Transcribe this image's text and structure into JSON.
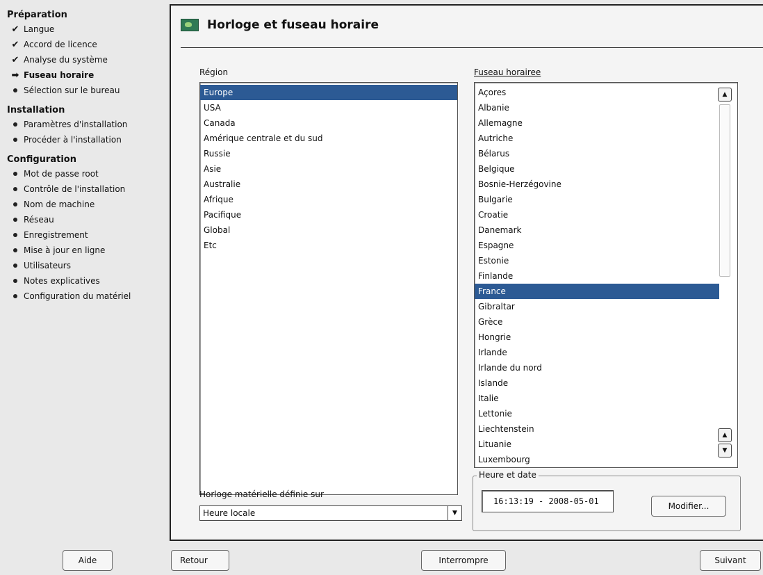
{
  "sidebar": {
    "sections": [
      {
        "title": "Préparation",
        "items": [
          {
            "label": "Langue",
            "state": "done"
          },
          {
            "label": "Accord de licence",
            "state": "done"
          },
          {
            "label": "Analyse du système",
            "state": "done"
          },
          {
            "label": "Fuseau horaire",
            "state": "current"
          },
          {
            "label": "Sélection sur le bureau",
            "state": "todo"
          }
        ]
      },
      {
        "title": "Installation",
        "items": [
          {
            "label": "Paramètres d'installation",
            "state": "todo"
          },
          {
            "label": "Procéder à l'installation",
            "state": "todo"
          }
        ]
      },
      {
        "title": "Configuration",
        "items": [
          {
            "label": "Mot de passe root",
            "state": "todo"
          },
          {
            "label": "Contrôle de l'installation",
            "state": "todo"
          },
          {
            "label": "Nom de machine",
            "state": "todo"
          },
          {
            "label": "Réseau",
            "state": "todo"
          },
          {
            "label": "Enregistrement",
            "state": "todo"
          },
          {
            "label": "Mise à jour en ligne",
            "state": "todo"
          },
          {
            "label": "Utilisateurs",
            "state": "todo"
          },
          {
            "label": "Notes explicatives",
            "state": "todo"
          },
          {
            "label": "Configuration du matériel",
            "state": "todo"
          }
        ]
      }
    ]
  },
  "panel": {
    "title": "Horloge et fuseau horaire",
    "region_label": "Région",
    "regions": [
      "Europe",
      "USA",
      "Canada",
      "Amérique centrale et du sud",
      "Russie",
      "Asie",
      "Australie",
      "Afrique",
      "Pacifique",
      "Global",
      "Etc"
    ],
    "selected_region": "Europe",
    "timezone_label": "Fuseau horairee",
    "timezones": [
      "Açores",
      "Albanie",
      "Allemagne",
      "Autriche",
      "Bélarus",
      "Belgique",
      "Bosnie-Herzégovine",
      "Bulgarie",
      "Croatie",
      "Danemark",
      "Espagne",
      "Estonie",
      "Finlande",
      "France",
      "Gibraltar",
      "Grèce",
      "Hongrie",
      "Irlande",
      "Irlande du nord",
      "Islande",
      "Italie",
      "Lettonie",
      "Liechtenstein",
      "Lituanie",
      "Luxembourg"
    ],
    "selected_timezone": "France",
    "hw_clock_label": "Horloge matérielle définie sur",
    "hw_clock_value": "Heure locale",
    "datetime_group": "Heure et date",
    "datetime_value": "16:13:19 - 2008-05-01",
    "modify_button": "Modifier..."
  },
  "footer": {
    "help": "Aide",
    "back": "Retour",
    "abort": "Interrompre",
    "next": "Suivant"
  },
  "colors": {
    "selection": "#2c5a94",
    "background": "#e9e9e9"
  }
}
